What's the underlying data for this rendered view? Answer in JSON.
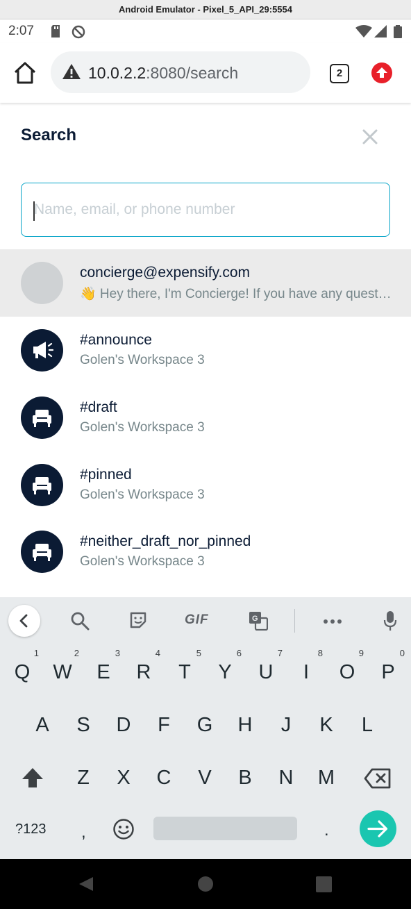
{
  "emulator": {
    "title": "Android Emulator - Pixel_5_API_29:5554"
  },
  "status_bar": {
    "time": "2:07"
  },
  "browser": {
    "url_host": "10.0.2.2",
    "url_rest": ":8080/search",
    "tab_count": "2"
  },
  "page": {
    "title": "Search",
    "search_placeholder": "Name, email, or phone number",
    "search_value": ""
  },
  "results": [
    {
      "name": "concierge@expensify.com",
      "subtitle": "👋 Hey there, I'm Concierge! If you have any questions, just ask",
      "avatar": "default-avatar",
      "selected": true
    },
    {
      "name": "#announce",
      "subtitle": "Golen's Workspace 3",
      "avatar": "megaphone-icon",
      "selected": false
    },
    {
      "name": "#draft",
      "subtitle": "Golen's Workspace 3",
      "avatar": "armchair-icon",
      "selected": false
    },
    {
      "name": "#pinned",
      "subtitle": "Golen's Workspace 3",
      "avatar": "armchair-icon",
      "selected": false
    },
    {
      "name": "#neither_draft_nor_pinned",
      "subtitle": "Golen's Workspace 3",
      "avatar": "armchair-icon",
      "selected": false
    }
  ],
  "keyboard": {
    "toolbar_gif": "GIF",
    "row1": [
      "Q",
      "W",
      "E",
      "R",
      "T",
      "Y",
      "U",
      "I",
      "O",
      "P"
    ],
    "row1_hints": [
      "1",
      "2",
      "3",
      "4",
      "5",
      "6",
      "7",
      "8",
      "9",
      "0"
    ],
    "row2": [
      "A",
      "S",
      "D",
      "F",
      "G",
      "H",
      "J",
      "K",
      "L"
    ],
    "row3": [
      "Z",
      "X",
      "C",
      "V",
      "B",
      "N",
      "M"
    ],
    "sym_label": "?123",
    "comma": ",",
    "period": "."
  },
  "colors": {
    "accent": "#03a3c7",
    "avatar_dark": "#0b1b34",
    "enter_key": "#1ac6b0",
    "update_badge": "#e8202a"
  }
}
